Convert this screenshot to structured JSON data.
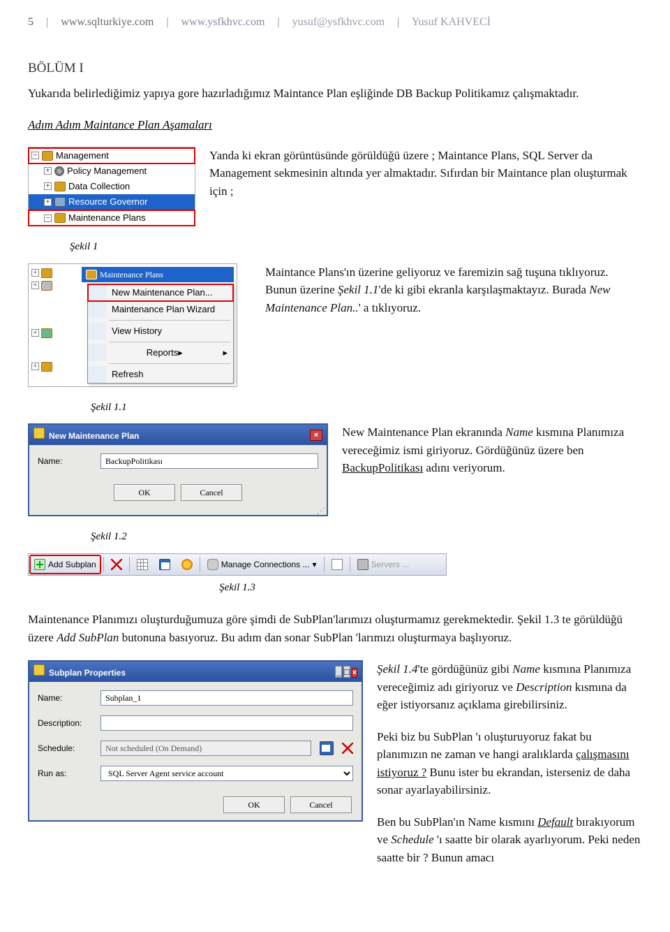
{
  "header": {
    "page_no": "5",
    "link1": "www.sqlturkiye.com",
    "link2": "www.ysfkhvc.com",
    "email": "yusuf@ysfkhvc.com",
    "author": "Yusuf KAHVECİ"
  },
  "section1": {
    "title": "BÖLÜM I",
    "para1": "Yukarıda belirlediğimiz yapıya gore hazırladığımız Maintance Plan eşliğinde DB Backup Politikamız çalışmaktadır.",
    "subheading": "Adım Adım Maintance Plan Aşamaları"
  },
  "tree1": {
    "items": [
      {
        "toggle": "−",
        "label": "Management"
      },
      {
        "toggle": "+",
        "label": "Policy Management"
      },
      {
        "toggle": "+",
        "label": "Data Collection"
      },
      {
        "toggle": "+",
        "label": "Resource Governor"
      },
      {
        "toggle": "−",
        "label": "Maintenance Plans"
      }
    ]
  },
  "para_tree1": "Yanda ki ekran görüntüsünde görüldüğü üzere ; Maintance Plans, SQL Server da Management sekmesinin altında yer almaktadır. Sıfırdan bir Maintance plan oluşturmak için ;",
  "fig1": "Şekil 1",
  "context_menu": {
    "parent_label": "Maintenance Plans",
    "items": [
      {
        "label": "New Maintenance Plan...",
        "hl": true
      },
      {
        "label": "Maintenance Plan Wizard"
      },
      {
        "sep": true
      },
      {
        "label": "View History"
      },
      {
        "sep": true
      },
      {
        "label": "Reports",
        "sub": true
      },
      {
        "sep": true
      },
      {
        "label": "Refresh"
      }
    ]
  },
  "para_ctx": "Maintance Plans'ın üzerine geliyoruz ve faremizin sağ tuşuna tıklıyoruz. Bunun üzerine ",
  "para_ctx_i1": "Şekil 1.1",
  "para_ctx_2": "'de ki gibi ekranla karşılaşmaktayız. Burada ",
  "para_ctx_i2": "New Maintenance Plan..",
  "para_ctx_3": "' a tıklıyoruz.",
  "fig11": "Şekil 1.1",
  "dlg_new": {
    "title": "New Maintenance Plan",
    "name_label": "Name:",
    "name_value": "BackupPolitikası",
    "ok": "OK",
    "cancel": "Cancel"
  },
  "para_dlg": "New Maintenance Plan ekranında ",
  "para_dlg_i1": "Name",
  "para_dlg_2": " kısmına Planımıza vereceğimiz ismi giriyoruz. Gördüğünüz üzere ben ",
  "para_dlg_u": "BackupPolitikası",
  "para_dlg_3": " adını veriyorum.",
  "fig12": "Şekil 1.2",
  "toolbar": {
    "add_subplan": "Add Subplan",
    "manage_conn": "Manage Connections ...",
    "servers": "Servers ..."
  },
  "fig13": "Şekil 1.3",
  "para_tb_1": "Maintenance Planımızı oluşturduğumuza göre şimdi de SubPlan'larımızı oluşturmamız gerekmektedir. Şekil 1.3 te görüldüğü üzere ",
  "para_tb_i": "Add SubPlan",
  "para_tb_2": " butonuna basıyoruz. Bu adım dan sonar SubPlan 'larımızı oluşturmaya başlıyoruz.",
  "dlg_sub": {
    "title": "Subplan Properties",
    "name_label": "Name:",
    "name_value": "Subplan_1",
    "desc_label": "Description:",
    "desc_value": "",
    "sched_label": "Schedule:",
    "sched_value": "Not scheduled (On Demand)",
    "runas_label": "Run as:",
    "runas_value": "SQL Server Agent service account",
    "ok": "OK",
    "cancel": "Cancel"
  },
  "para_sub_1a": "Şekil 1.4",
  "para_sub_1b": "'te gördüğünüz gibi ",
  "para_sub_1i1": "Name",
  "para_sub_1c": " kısmına Planımıza vereceğimiz adı giriyoruz ve ",
  "para_sub_1i2": "Description",
  "para_sub_1d": " kısmına da eğer istiyorsanız açıklama girebilirsiniz.",
  "para_sub_2a": "Peki biz bu SubPlan 'ı oluşturuyoruz fakat bu planımızın ne zaman ve hangi aralıklarda ",
  "para_sub_2u": "çalışmasını istiyoruz ?",
  "para_sub_2b": " Bunu ister bu ekrandan, isterseniz de daha sonar ayarlayabilirsiniz.",
  "para_sub_3a": "Ben bu SubPlan'ın Name kısmını ",
  "para_sub_3i1": "Default",
  "para_sub_3b": " bırakıyorum ve ",
  "para_sub_3i2": "Schedule",
  "para_sub_3c": " 'ı saatte bir olarak ayarlıyorum. Peki neden saatte bir ? Bunun amacı"
}
